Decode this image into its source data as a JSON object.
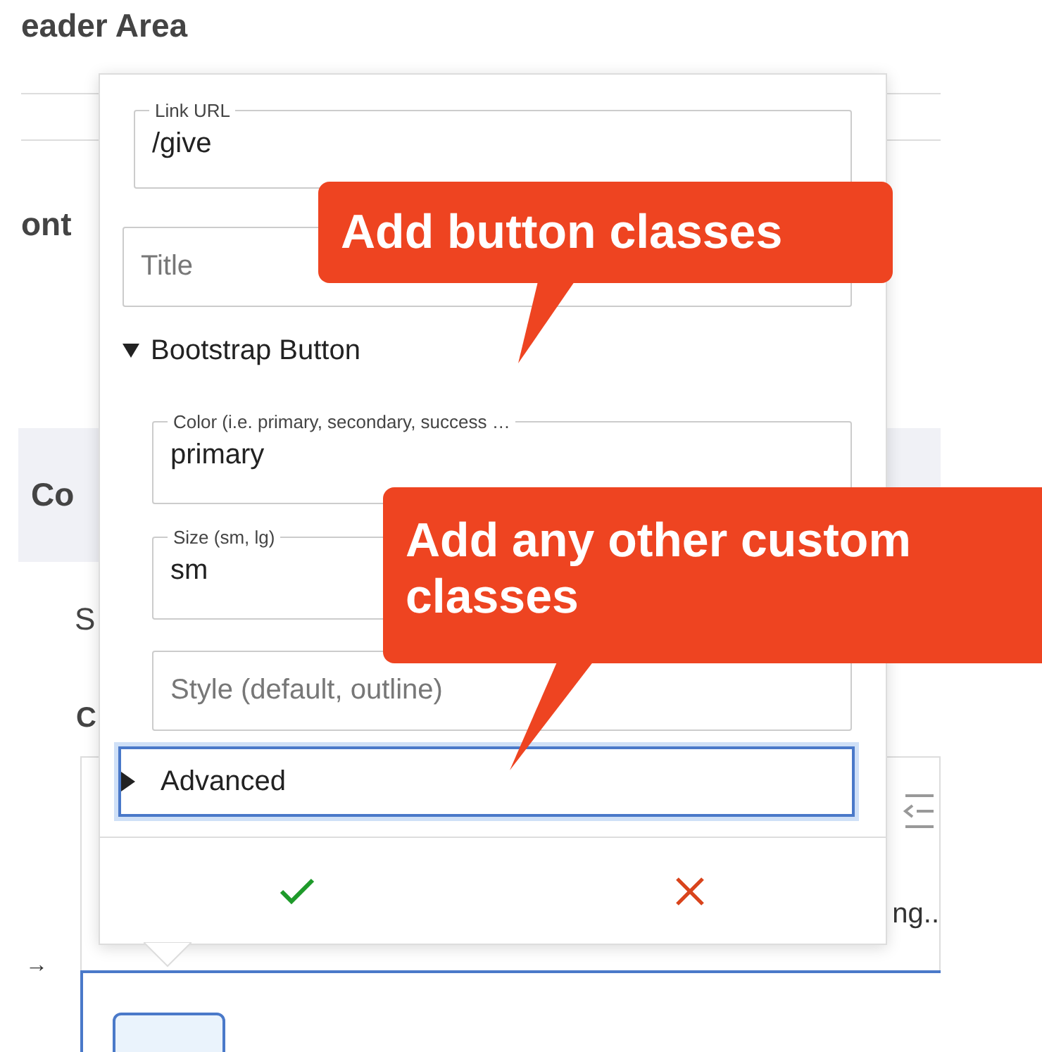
{
  "background": {
    "heading": "eader Area",
    "section_heading": "ont",
    "panel_heading": "Co",
    "label_1": "S",
    "label_2": "C",
    "editor_text": "ng..",
    "arrow_glyph": "→"
  },
  "popup": {
    "fields": [
      {
        "kind": "outlined",
        "label": "Link URL",
        "value": "/give"
      },
      {
        "kind": "plain",
        "placeholder": "Title"
      }
    ],
    "group": {
      "title": "Bootstrap Button",
      "expanded": true,
      "fields": [
        {
          "kind": "outlined",
          "label": "Color (i.e. primary, secondary, success …",
          "value": "primary"
        },
        {
          "kind": "outlined",
          "label": "Size (sm, lg)",
          "value": "sm"
        },
        {
          "kind": "plain",
          "placeholder": "Style (default, outline)"
        }
      ]
    },
    "advanced": {
      "title": "Advanced",
      "expanded": false,
      "focused": true
    }
  },
  "callouts": [
    {
      "text": "Add button classes"
    },
    {
      "text": "Add any other custom classes"
    }
  ]
}
